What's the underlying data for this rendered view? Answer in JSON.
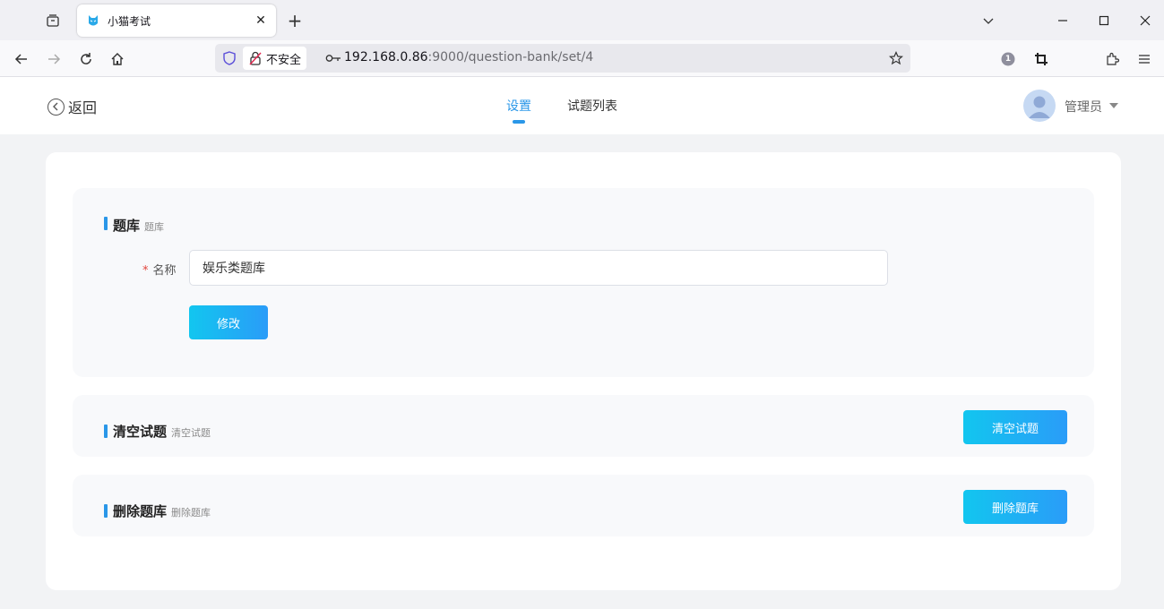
{
  "browser": {
    "tab_title": "小猫考试",
    "insecure_label": "不安全",
    "url_host": "192.168.0.86",
    "url_rest": ":9000/question-bank/set/4",
    "extension_badge": "1"
  },
  "header": {
    "back_label": "返回",
    "tabs": [
      {
        "label": "设置",
        "active": true
      },
      {
        "label": "试题列表",
        "active": false
      }
    ],
    "user_name": "管理员"
  },
  "bank_section": {
    "title": "题库",
    "subtitle": "题库",
    "name_label": "名称",
    "required_mark": "*",
    "name_value": "娱乐类题库",
    "modify_button": "修改"
  },
  "clear_section": {
    "title": "清空试题",
    "subtitle": "清空试题",
    "button": "清空试题"
  },
  "delete_section": {
    "title": "删除题库",
    "subtitle": "删除题库",
    "button": "删除题库"
  },
  "colors": {
    "accent": "#2a97e8",
    "button_gradient_start": "#12c6ef",
    "button_gradient_end": "#2a9cf8",
    "required": "#e2453c"
  }
}
